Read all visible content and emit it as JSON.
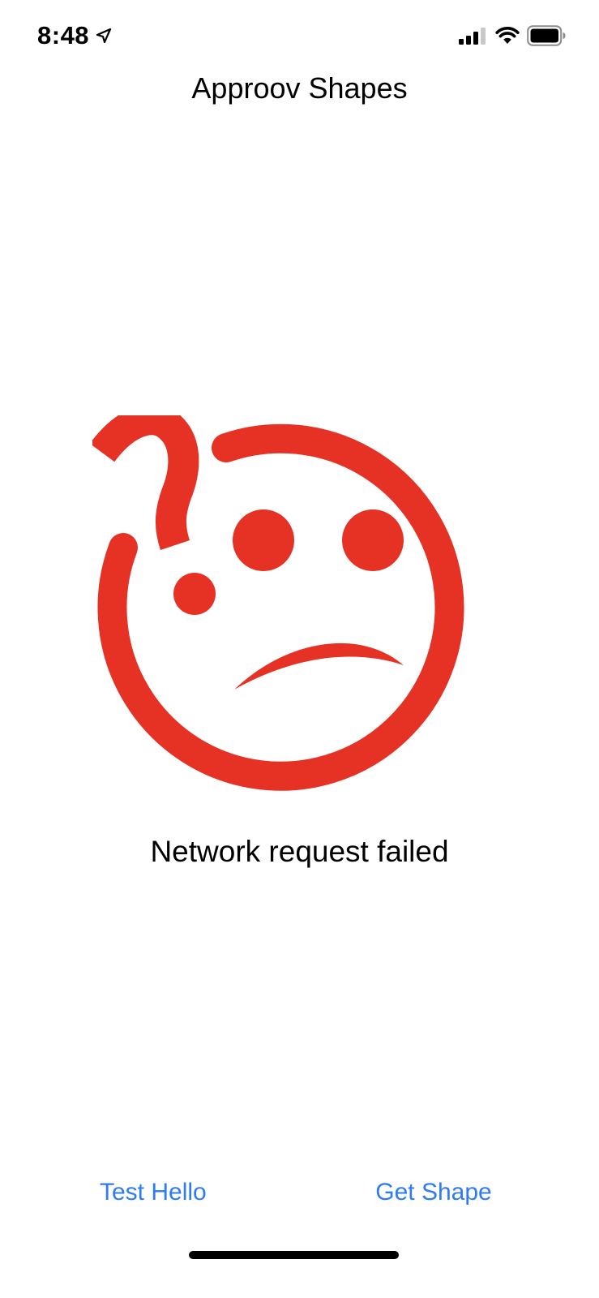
{
  "status_bar": {
    "time": "8:48",
    "icons": [
      "location-arrow-icon",
      "cellular-signal-icon",
      "wifi-icon",
      "battery-icon"
    ]
  },
  "header": {
    "title": "Approov Shapes"
  },
  "main": {
    "illustration": "confused-sad-face-with-question-mark",
    "message": "Network request failed"
  },
  "footer": {
    "test_hello_label": "Test Hello",
    "get_shape_label": "Get Shape"
  },
  "colors": {
    "accent": "#2f7bf5",
    "error_red": "#e63225",
    "background": "#ffffff",
    "text": "#000000"
  }
}
